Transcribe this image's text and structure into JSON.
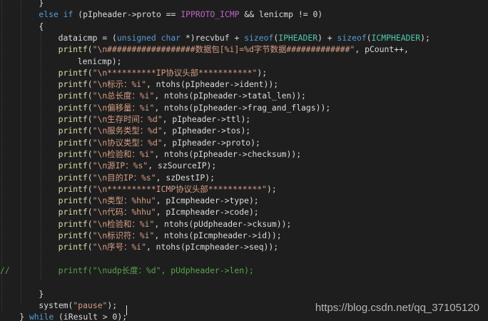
{
  "lines": [
    {
      "indent": 4,
      "tokens": [
        {
          "c": "plain",
          "t": "}"
        }
      ]
    },
    {
      "indent": 4,
      "tokens": [
        {
          "c": "kw",
          "t": "else if"
        },
        {
          "c": "plain",
          "t": " (pIpheader->proto == "
        },
        {
          "c": "macro",
          "t": "IPPROTO_ICMP"
        },
        {
          "c": "plain",
          "t": " && lenicmp != 0)"
        }
      ]
    },
    {
      "indent": 4,
      "tokens": [
        {
          "c": "plain",
          "t": "{"
        }
      ]
    },
    {
      "indent": 6,
      "tokens": [
        {
          "c": "plain",
          "t": "dataicmp = ("
        },
        {
          "c": "kw",
          "t": "unsigned char"
        },
        {
          "c": "plain",
          "t": " *)recvbuf + "
        },
        {
          "c": "kw",
          "t": "sizeof"
        },
        {
          "c": "plain",
          "t": "("
        },
        {
          "c": "type",
          "t": "IPHEADER"
        },
        {
          "c": "plain",
          "t": ") + "
        },
        {
          "c": "kw",
          "t": "sizeof"
        },
        {
          "c": "plain",
          "t": "("
        },
        {
          "c": "type",
          "t": "ICMPHEADER"
        },
        {
          "c": "plain",
          "t": ");"
        }
      ]
    },
    {
      "indent": 6,
      "tokens": [
        {
          "c": "fn",
          "t": "printf"
        },
        {
          "c": "plain",
          "t": "("
        },
        {
          "c": "str",
          "t": "\"\\n##################数据包[%i]=%d字节数据#############\""
        },
        {
          "c": "plain",
          "t": ", pCount++,"
        }
      ]
    },
    {
      "indent": 8,
      "tokens": [
        {
          "c": "plain",
          "t": "lenicmp);"
        }
      ]
    },
    {
      "indent": 6,
      "tokens": [
        {
          "c": "fn",
          "t": "printf"
        },
        {
          "c": "plain",
          "t": "("
        },
        {
          "c": "str",
          "t": "\"\\n**********IP协议头部***********\""
        },
        {
          "c": "plain",
          "t": ");"
        }
      ]
    },
    {
      "indent": 6,
      "tokens": [
        {
          "c": "fn",
          "t": "printf"
        },
        {
          "c": "plain",
          "t": "("
        },
        {
          "c": "str",
          "t": "\"\\n标示：%i\""
        },
        {
          "c": "plain",
          "t": ", ntohs(pIpheader->ident));"
        }
      ]
    },
    {
      "indent": 6,
      "tokens": [
        {
          "c": "fn",
          "t": "printf"
        },
        {
          "c": "plain",
          "t": "("
        },
        {
          "c": "str",
          "t": "\"\\n总长度：%i\""
        },
        {
          "c": "plain",
          "t": ", ntohs(pIpheader->tatal_len));"
        }
      ]
    },
    {
      "indent": 6,
      "tokens": [
        {
          "c": "fn",
          "t": "printf"
        },
        {
          "c": "plain",
          "t": "("
        },
        {
          "c": "str",
          "t": "\"\\n偏移量：%i\""
        },
        {
          "c": "plain",
          "t": ", ntohs(pIpheader->frag_and_flags));"
        }
      ]
    },
    {
      "indent": 6,
      "tokens": [
        {
          "c": "fn",
          "t": "printf"
        },
        {
          "c": "plain",
          "t": "("
        },
        {
          "c": "str",
          "t": "\"\\n生存时间：%d\""
        },
        {
          "c": "plain",
          "t": ", pIpheader->ttl);"
        }
      ]
    },
    {
      "indent": 6,
      "tokens": [
        {
          "c": "fn",
          "t": "printf"
        },
        {
          "c": "plain",
          "t": "("
        },
        {
          "c": "str",
          "t": "\"\\n服务类型：%d\""
        },
        {
          "c": "plain",
          "t": ", pIpheader->tos);"
        }
      ]
    },
    {
      "indent": 6,
      "tokens": [
        {
          "c": "fn",
          "t": "printf"
        },
        {
          "c": "plain",
          "t": "("
        },
        {
          "c": "str",
          "t": "\"\\n协议类型：%d\""
        },
        {
          "c": "plain",
          "t": ", pIpheader->proto);"
        }
      ]
    },
    {
      "indent": 6,
      "tokens": [
        {
          "c": "fn",
          "t": "printf"
        },
        {
          "c": "plain",
          "t": "("
        },
        {
          "c": "str",
          "t": "\"\\n检验和：%i\""
        },
        {
          "c": "plain",
          "t": ", ntohs(pIpheader->checksum));"
        }
      ]
    },
    {
      "indent": 6,
      "tokens": [
        {
          "c": "fn",
          "t": "printf"
        },
        {
          "c": "plain",
          "t": "("
        },
        {
          "c": "str",
          "t": "\"\\n源IP：%s\""
        },
        {
          "c": "plain",
          "t": ", szSourceIP);"
        }
      ]
    },
    {
      "indent": 6,
      "tokens": [
        {
          "c": "fn",
          "t": "printf"
        },
        {
          "c": "plain",
          "t": "("
        },
        {
          "c": "str",
          "t": "\"\\n目的IP：%s\""
        },
        {
          "c": "plain",
          "t": ", szDestIP);"
        }
      ]
    },
    {
      "indent": 6,
      "tokens": [
        {
          "c": "fn",
          "t": "printf"
        },
        {
          "c": "plain",
          "t": "("
        },
        {
          "c": "str",
          "t": "\"\\n**********ICMP协议头部***********\""
        },
        {
          "c": "plain",
          "t": ");"
        }
      ]
    },
    {
      "indent": 6,
      "tokens": [
        {
          "c": "fn",
          "t": "printf"
        },
        {
          "c": "plain",
          "t": "("
        },
        {
          "c": "str",
          "t": "\"\\n类型：%hhu\""
        },
        {
          "c": "plain",
          "t": ", pIcmpheader->type);"
        }
      ]
    },
    {
      "indent": 6,
      "tokens": [
        {
          "c": "fn",
          "t": "printf"
        },
        {
          "c": "plain",
          "t": "("
        },
        {
          "c": "str",
          "t": "\"\\n代码：%hhu\""
        },
        {
          "c": "plain",
          "t": ", pIcmpheader->code);"
        }
      ]
    },
    {
      "indent": 6,
      "tokens": [
        {
          "c": "fn",
          "t": "printf"
        },
        {
          "c": "plain",
          "t": "("
        },
        {
          "c": "str",
          "t": "\"\\n检验和：%i\""
        },
        {
          "c": "plain",
          "t": ", ntohs(pUdpheader->cksum));"
        }
      ]
    },
    {
      "indent": 6,
      "tokens": [
        {
          "c": "fn",
          "t": "printf"
        },
        {
          "c": "plain",
          "t": "("
        },
        {
          "c": "str",
          "t": "\"\\n标识符：%i\""
        },
        {
          "c": "plain",
          "t": ", ntohs(pIcmpheader->id));"
        }
      ]
    },
    {
      "indent": 6,
      "tokens": [
        {
          "c": "fn",
          "t": "printf"
        },
        {
          "c": "plain",
          "t": "("
        },
        {
          "c": "str",
          "t": "\"\\n序号：%i\""
        },
        {
          "c": "plain",
          "t": ", ntohs(pIcmpheader->seq));"
        }
      ]
    },
    {
      "indent": 0,
      "tokens": []
    },
    {
      "indent": 6,
      "comment_mark": "//",
      "tokens": [
        {
          "c": "comment",
          "t": "printf(\"\\nudp长度：%d\", pUdpheader->len);"
        }
      ]
    },
    {
      "indent": 0,
      "tokens": []
    },
    {
      "indent": 4,
      "tokens": [
        {
          "c": "plain",
          "t": "}"
        }
      ]
    },
    {
      "indent": 4,
      "tokens": [
        {
          "c": "plain",
          "t": "system("
        },
        {
          "c": "str",
          "t": "\"pause\""
        },
        {
          "c": "plain",
          "t": ");"
        }
      ]
    },
    {
      "indent": 2,
      "tokens": [
        {
          "c": "plain",
          "t": "} "
        },
        {
          "c": "kw",
          "t": "while"
        },
        {
          "c": "plain",
          "t": " (iResult > 0);"
        }
      ]
    }
  ],
  "watermark": "https://blog.csdn.net/qq_37105120",
  "colors": {
    "background": "#1e1e1e",
    "keyword": "#569cd6",
    "string": "#d69d85",
    "type": "#4ec9b0",
    "function": "#dcdcaa",
    "macro": "#bd63c5",
    "comment": "#57a64a",
    "plain": "#dcdcdc"
  }
}
